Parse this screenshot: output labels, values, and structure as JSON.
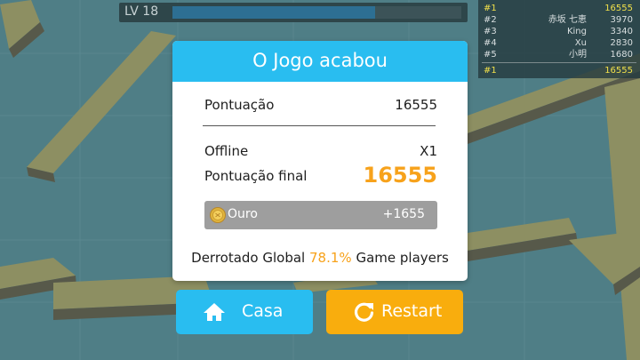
{
  "hud": {
    "level_label": "LV 18",
    "level_progress": 0.7
  },
  "leaderboard": {
    "rows": [
      {
        "rank": "#1",
        "name": "",
        "score": "16555",
        "highlight": true
      },
      {
        "rank": "#2",
        "name": "赤坂 七恵",
        "score": "3970"
      },
      {
        "rank": "#3",
        "name": "King",
        "score": "3340"
      },
      {
        "rank": "#4",
        "name": "Xu",
        "score": "2830"
      },
      {
        "rank": "#5",
        "name": "小明",
        "score": "1680"
      }
    ],
    "self": {
      "rank": "#1",
      "score": "16555"
    }
  },
  "dialog": {
    "title": "O Jogo acabou",
    "score_label": "Pontuação",
    "score_value": "16555",
    "offline_label": "Offline",
    "offline_value": "X1",
    "final_label": "Pontuação final",
    "final_value": "16555",
    "gold_label": "Ouro",
    "gold_value": "+1655",
    "beat_prefix": "Derrotado Global",
    "beat_percent": "78.1%",
    "beat_suffix": "Game players"
  },
  "buttons": {
    "home_label": "Casa",
    "restart_label": "Restart"
  },
  "colors": {
    "accent_blue": "#29bdf0",
    "accent_orange": "#f9ad0d",
    "highlight_yellow": "#f1e04a"
  }
}
